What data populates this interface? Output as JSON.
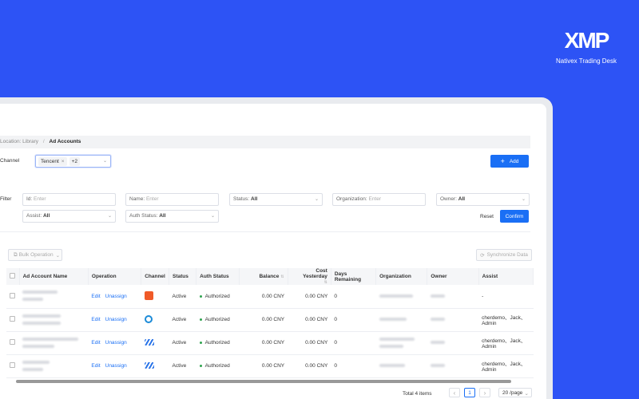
{
  "brand": {
    "logo": "XMP",
    "name": "Nativex Trading Desk"
  },
  "breadcrumb": {
    "first": "Location: Library",
    "separator": "/",
    "current": "Ad Accounts"
  },
  "channel": {
    "label": "Channel",
    "tag": "Tencent",
    "tag_close": "×",
    "more": "+2"
  },
  "add_button": {
    "icon": "plus-icon",
    "label": "Add"
  },
  "filter": {
    "label": "Filter",
    "id": {
      "label": "Id:",
      "placeholder": "Enter"
    },
    "name": {
      "label": "Name:",
      "placeholder": "Enter"
    },
    "status": {
      "label": "Status:",
      "value": "All"
    },
    "organization": {
      "label": "Organization:",
      "placeholder": "Enter"
    },
    "owner": {
      "label": "Owner:",
      "value": "All"
    },
    "assist": {
      "label": "Assist:",
      "value": "All"
    },
    "auth_status": {
      "label": "Auth Status:",
      "value": "All"
    },
    "reset": "Reset",
    "confirm": "Confirm"
  },
  "toolbar": {
    "bulk": "Bulk Operation",
    "sync": "Synchronize Data"
  },
  "table": {
    "columns": [
      "Ad Account Name",
      "Operation",
      "Channel",
      "Status",
      "Auth Status",
      "Balance",
      "Cost Yesterday",
      "Days Remaining",
      "Organization",
      "Owner",
      "Assist"
    ],
    "edit_label": "Edit",
    "unassign_label": "Unassign",
    "rows": [
      {
        "channel_icon": "tencent-icon",
        "status": "Active",
        "auth": "Authorized",
        "balance": "0.00 CNY",
        "cost": "0.00 CNY",
        "days": "0",
        "assist": [
          "-"
        ]
      },
      {
        "channel_icon": "kuaishou-icon",
        "status": "Active",
        "auth": "Authorized",
        "balance": "0.00 CNY",
        "cost": "0.00 CNY",
        "days": "0",
        "assist": [
          "cherdemo、Jack、",
          "Admin"
        ]
      },
      {
        "channel_icon": "stripes-channel-icon",
        "status": "Active",
        "auth": "Authorized",
        "balance": "0.00 CNY",
        "cost": "0.00 CNY",
        "days": "0",
        "assist": [
          "cherdemo、Jack、",
          "Admin"
        ]
      },
      {
        "channel_icon": "stripes-channel-icon",
        "status": "Active",
        "auth": "Authorized",
        "balance": "0.00 CNY",
        "cost": "0.00 CNY",
        "days": "0",
        "assist": [
          "cherdemo、Jack、",
          "Admin"
        ]
      }
    ]
  },
  "pagination": {
    "total": "Total 4 items",
    "prev": "‹",
    "page": "1",
    "next": "›",
    "size": "20 /page"
  },
  "colors": {
    "background": "#2d53f5",
    "primary": "#1a6ff5",
    "authorized": "#2fa34f"
  }
}
